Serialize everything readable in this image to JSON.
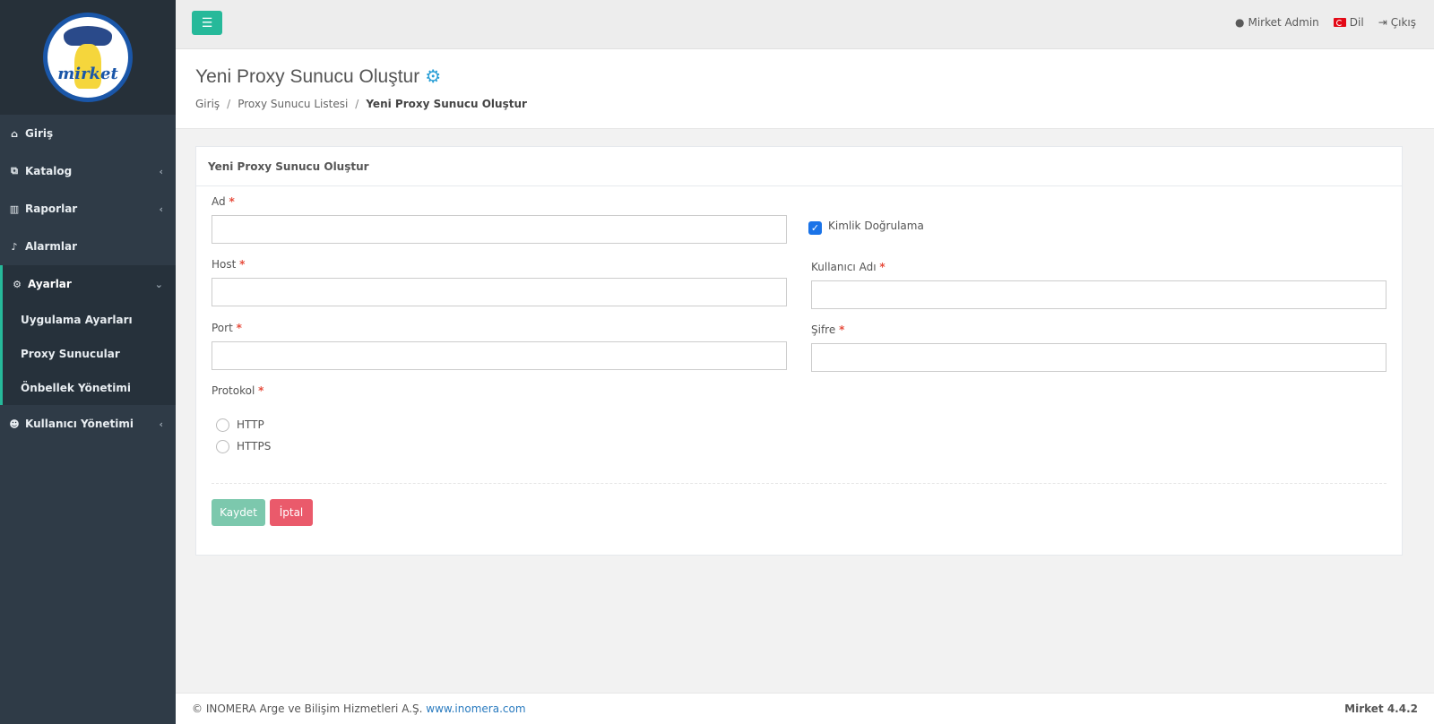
{
  "brand": {
    "logo_text": "mirket"
  },
  "sidebar": {
    "items": [
      {
        "label": "Giriş",
        "icon": "home-icon"
      },
      {
        "label": "Katalog",
        "icon": "sitemap-icon"
      },
      {
        "label": "Raporlar",
        "icon": "chart-icon"
      },
      {
        "label": "Alarmlar",
        "icon": "bell-icon"
      },
      {
        "label": "Ayarlar",
        "icon": "gears-icon",
        "active": true,
        "children": [
          {
            "label": "Uygulama Ayarları"
          },
          {
            "label": "Proxy Sunucular"
          },
          {
            "label": "Önbellek Yönetimi"
          }
        ]
      },
      {
        "label": "Kullanıcı Yönetimi",
        "icon": "users-icon"
      }
    ]
  },
  "topbar": {
    "user": "Mirket Admin",
    "language": "Dil",
    "logout": "Çıkış"
  },
  "page": {
    "title": "Yeni Proxy Sunucu Oluştur",
    "breadcrumb": [
      "Giriş",
      "Proxy Sunucu Listesi",
      "Yeni Proxy Sunucu Oluştur"
    ]
  },
  "form": {
    "panel_title": "Yeni Proxy Sunucu Oluştur",
    "name_label": "Ad",
    "name_value": "",
    "host_label": "Host",
    "host_value": "",
    "port_label": "Port",
    "port_value": "",
    "protocol_label": "Protokol",
    "protocol_options": [
      "HTTP",
      "HTTPS"
    ],
    "auth_label": "Kimlik Doğrulama",
    "auth_checked": true,
    "username_label": "Kullanıcı Adı",
    "username_value": "",
    "password_label": "Şifre",
    "password_value": "",
    "required_mark": "*",
    "save_label": "Kaydet",
    "cancel_label": "İptal"
  },
  "footer": {
    "copyright": "© INOMERA Arge ve Bilişim Hizmetleri A.Ş.",
    "link": "www.inomera.com",
    "version": "Mirket 4.4.2"
  },
  "colors": {
    "sidebar": "#2f3b47",
    "accent": "#26b99a",
    "danger": "#ea5a6b",
    "checkbox": "#1a73e8"
  }
}
